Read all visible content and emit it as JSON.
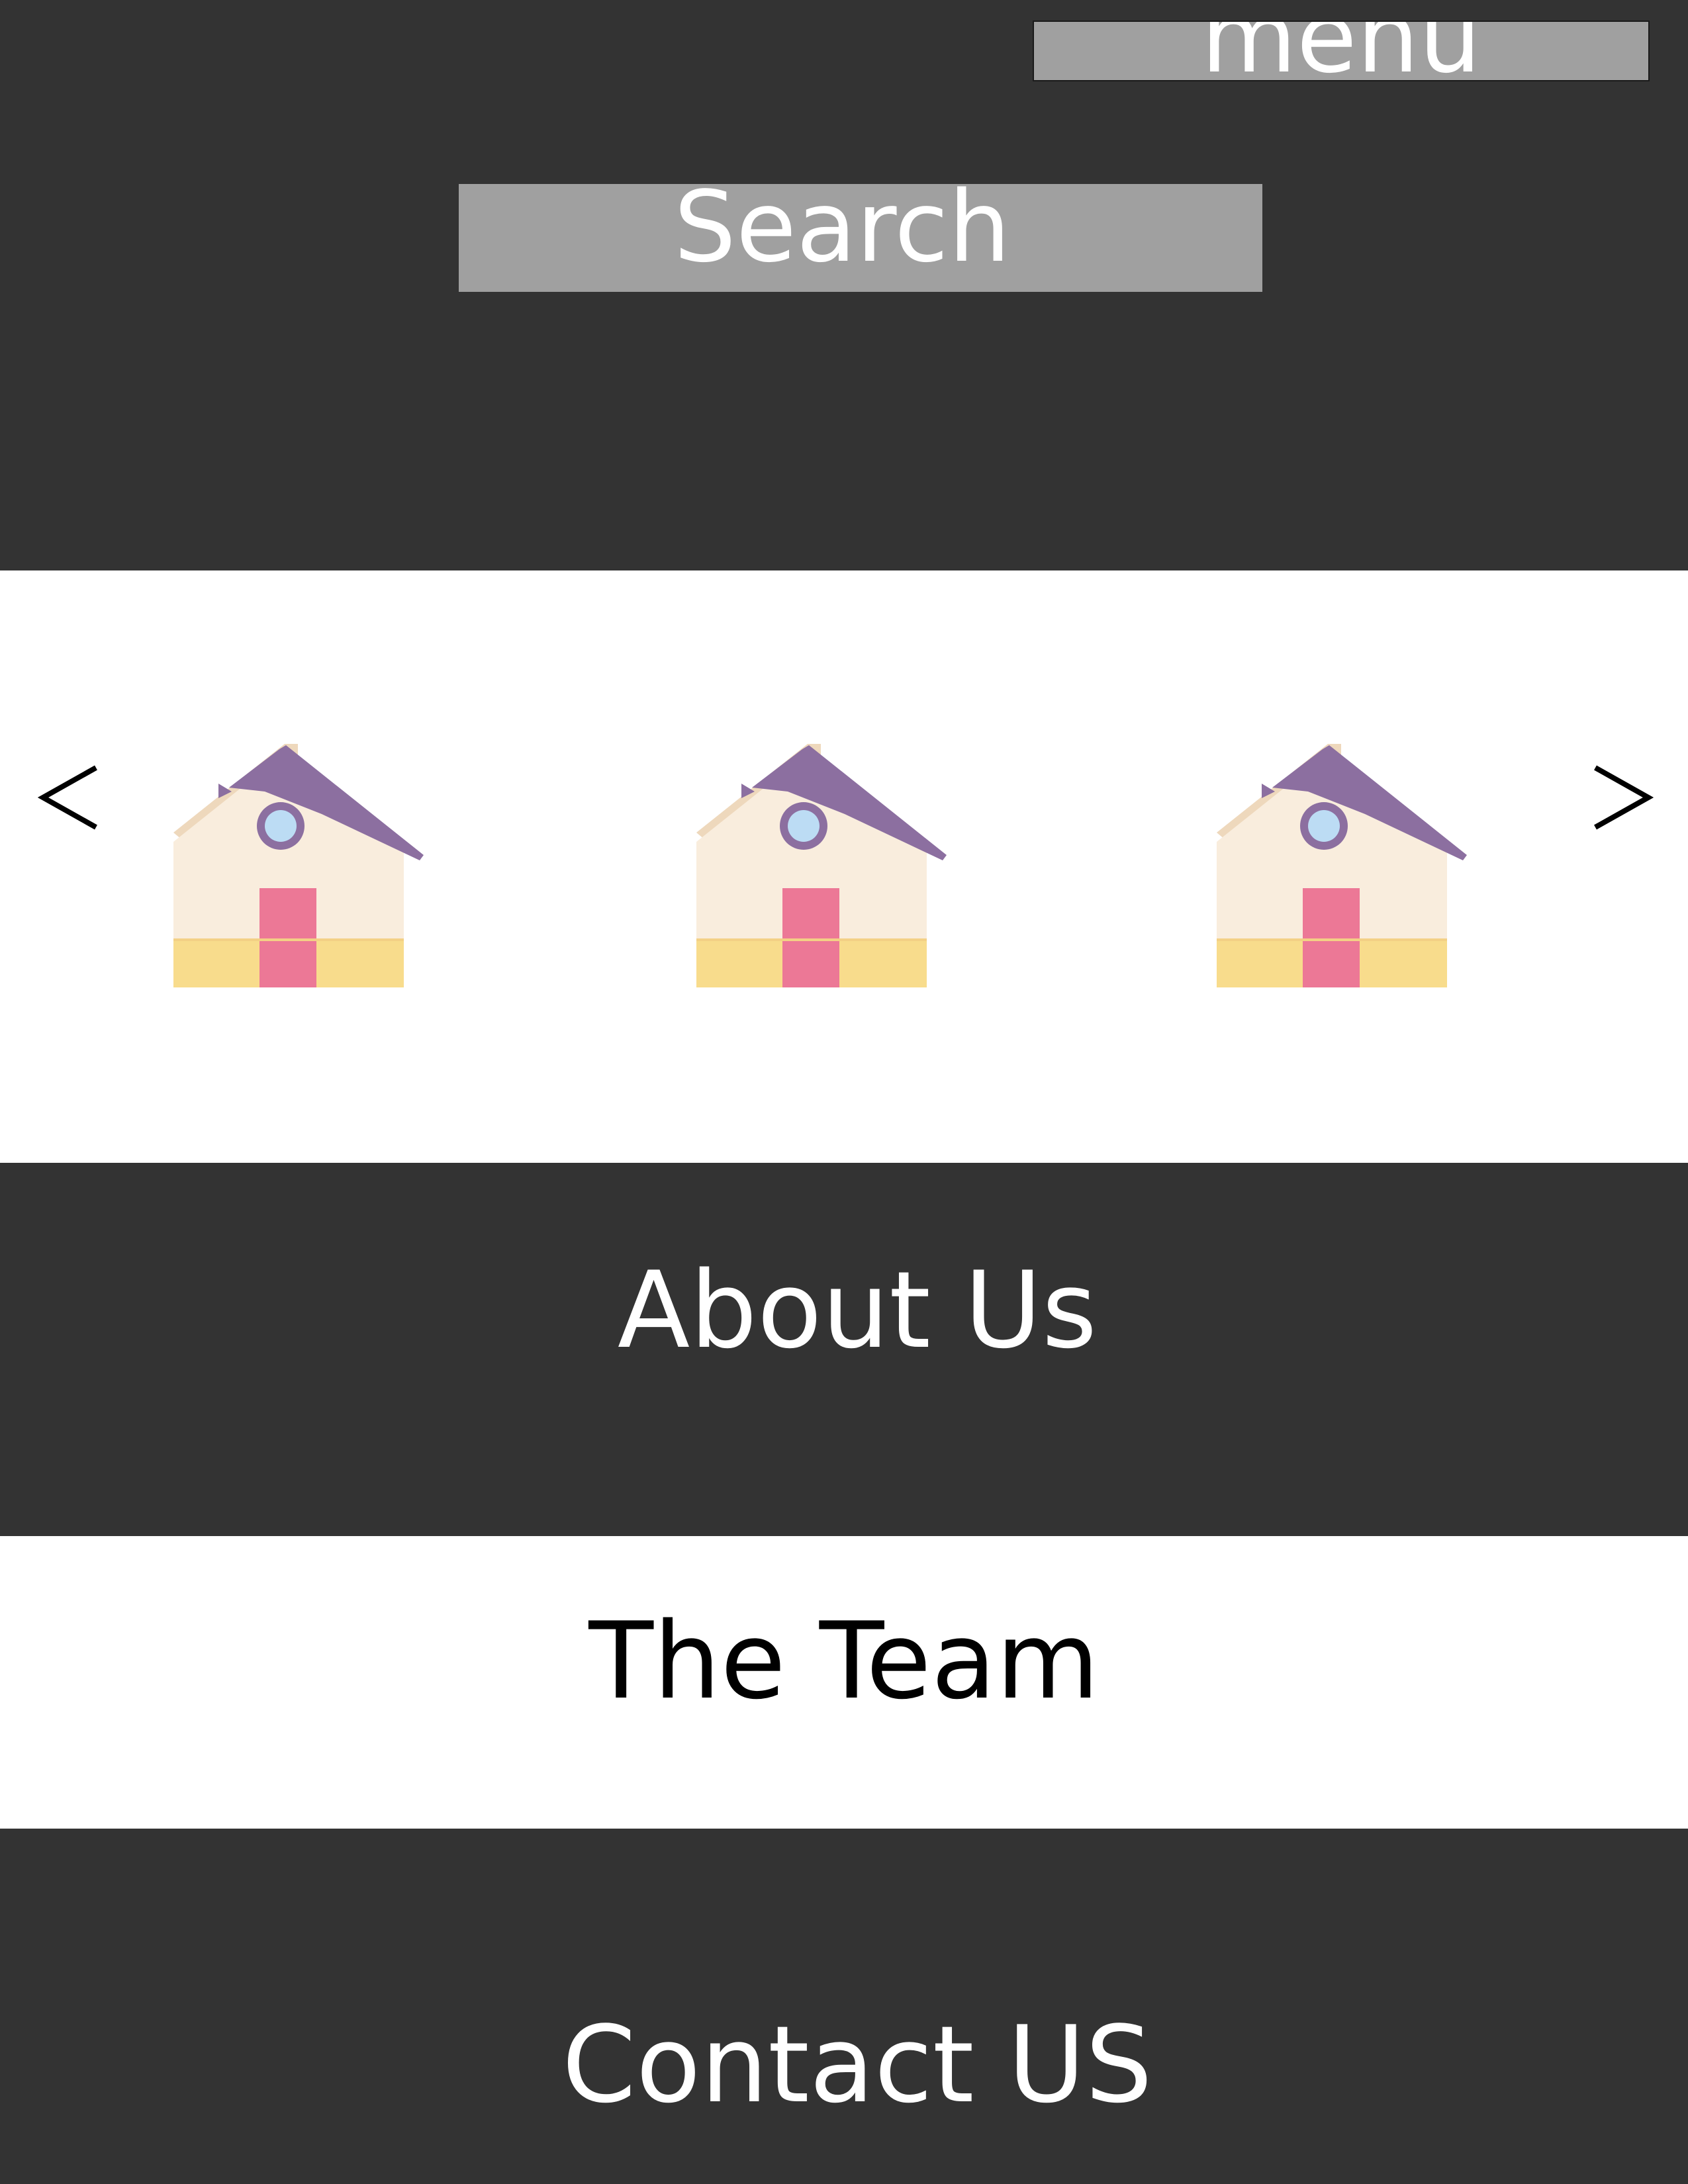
{
  "header": {
    "menu_label": "menu",
    "search_label": "Search"
  },
  "carousel": {
    "prev_label": "<",
    "next_label": ">",
    "items": [
      {
        "icon": "house-icon"
      },
      {
        "icon": "house-icon"
      },
      {
        "icon": "house-icon"
      }
    ]
  },
  "sections": {
    "about": "About Us",
    "team": "The Team",
    "contact": "Contact US"
  },
  "colors": {
    "dark_band": "#333333",
    "button_gray": "#a0a0a0",
    "roof": "#8c6fa0",
    "wall": "#f9eddd",
    "base": "#f8dc8c",
    "door": "#ec7896",
    "window": "#bcdcf4"
  }
}
